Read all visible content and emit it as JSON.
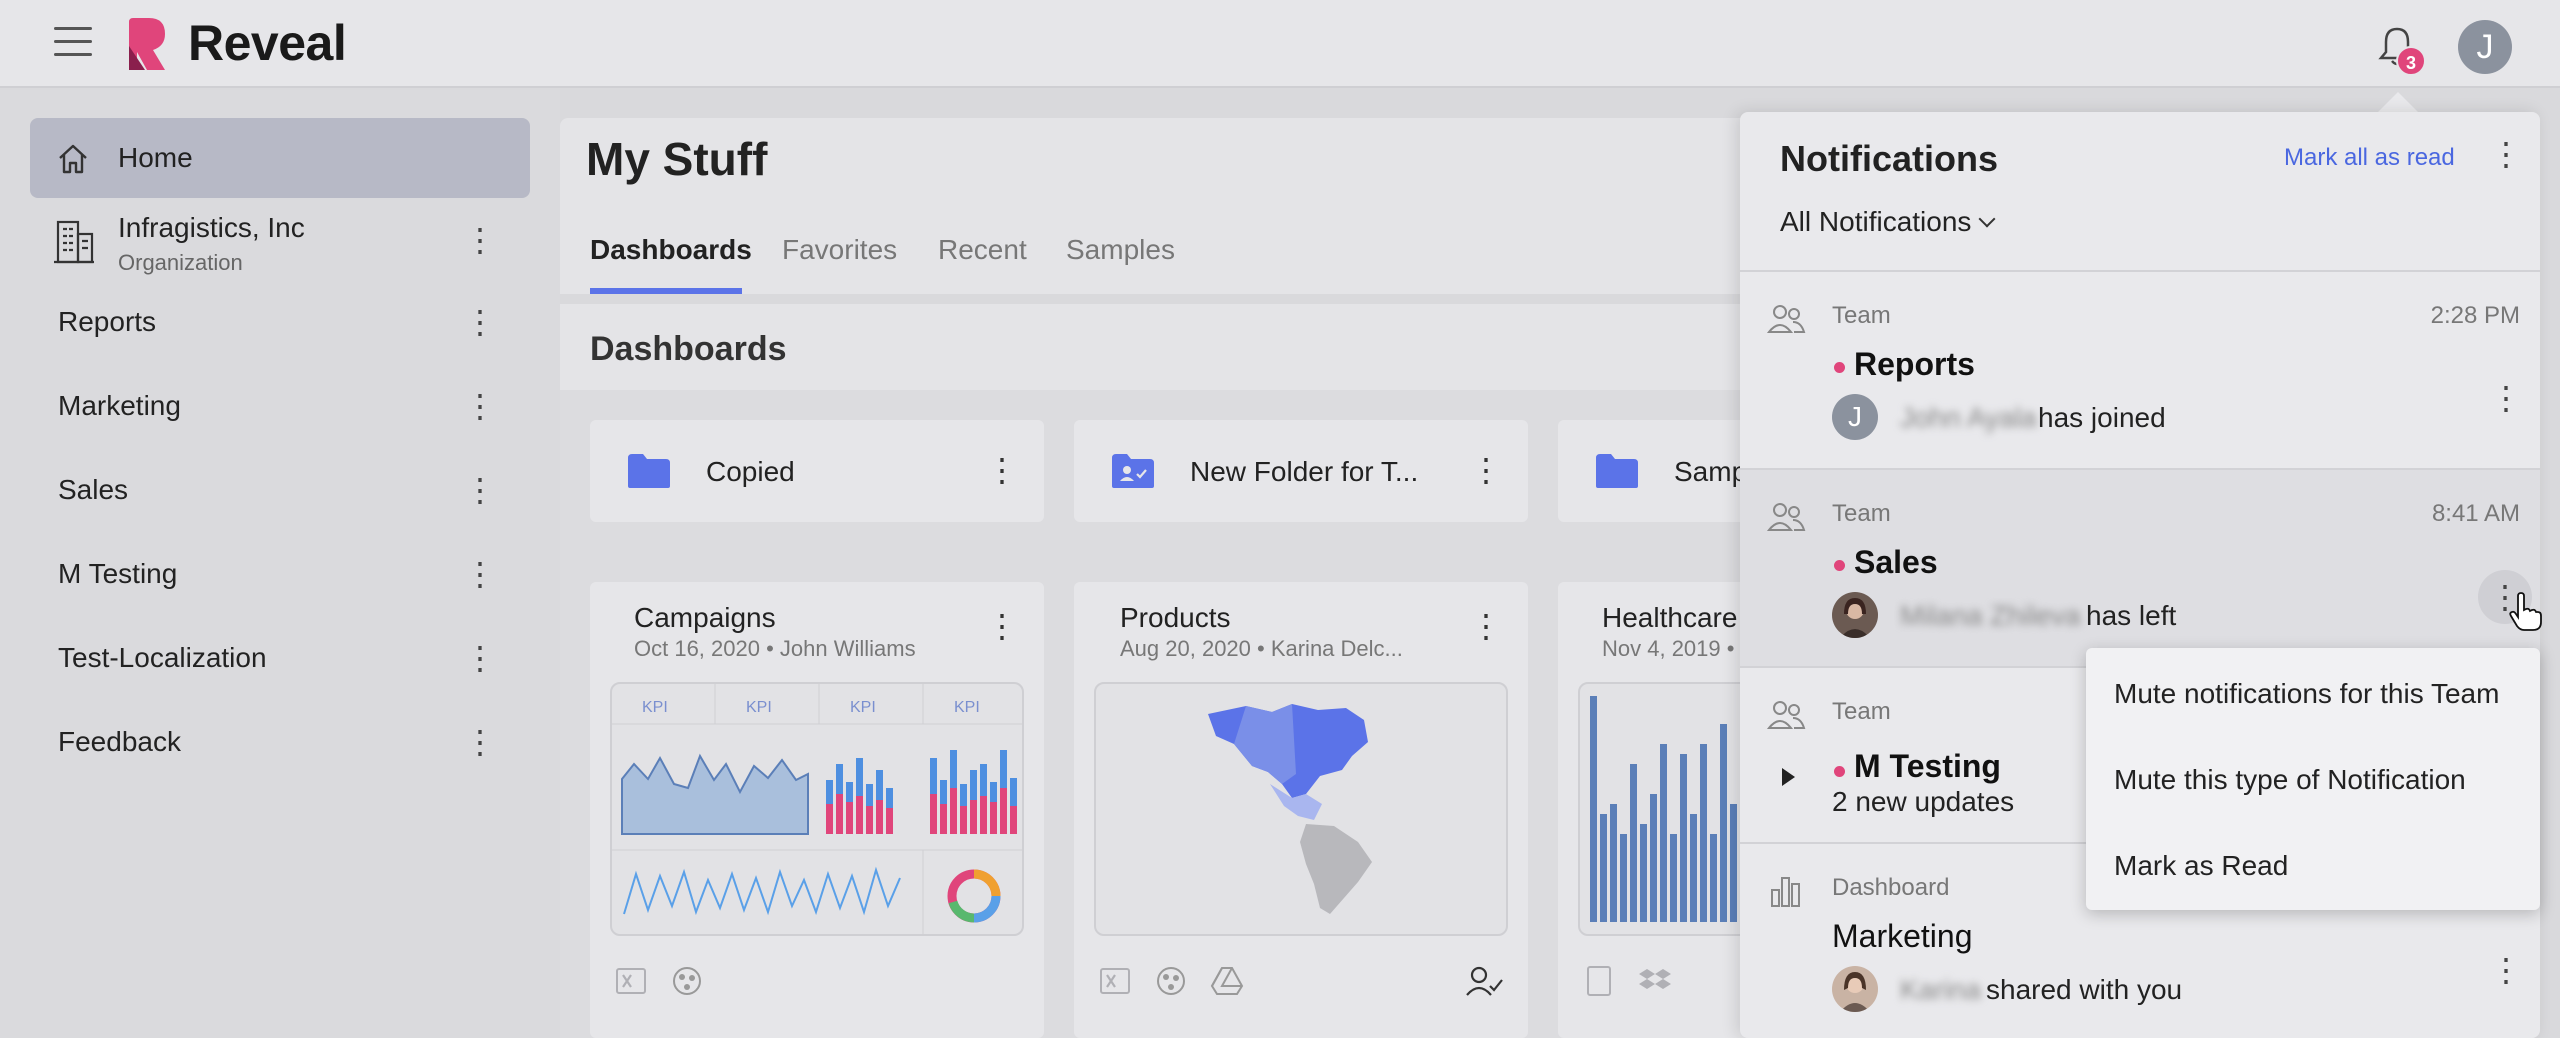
{
  "app": {
    "brand": "Reveal",
    "user_initial": "J",
    "notification_count": "3"
  },
  "sidebar": {
    "items": [
      {
        "label": "Home",
        "active": true
      },
      {
        "label": "Infragistics, Inc",
        "sublabel": "Organization"
      },
      {
        "label": "Reports"
      },
      {
        "label": "Marketing"
      },
      {
        "label": "Sales"
      },
      {
        "label": "M Testing"
      },
      {
        "label": "Test-Localization"
      },
      {
        "label": "Feedback"
      }
    ]
  },
  "main": {
    "title": "My Stuff",
    "tabs": [
      "Dashboards",
      "Favorites",
      "Recent",
      "Samples"
    ],
    "section_title": "Dashboards",
    "folders": [
      {
        "label": "Copied"
      },
      {
        "label": "New Folder for T..."
      },
      {
        "label": "Samp"
      }
    ],
    "dashboards": [
      {
        "title": "Campaigns",
        "meta": "Oct 16, 2020 • John Williams"
      },
      {
        "title": "Products",
        "meta": "Aug 20, 2020 • Karina Delc..."
      },
      {
        "title": "Healthcare",
        "meta": "Nov 4, 2019 •"
      }
    ],
    "kpi_label": "KPI"
  },
  "notifications": {
    "title": "Notifications",
    "mark_all": "Mark all as read",
    "filter": "All Notifications",
    "items": [
      {
        "category": "Team",
        "time": "2:28 PM",
        "name": "Reports",
        "avatar": "J",
        "actor": "John Ayala",
        "action": "has joined"
      },
      {
        "category": "Team",
        "time": "8:41 AM",
        "name": "Sales",
        "actor": "Milana Zhileva",
        "action": "has left"
      },
      {
        "category": "Team",
        "time": "",
        "name": "M Testing",
        "sub": "2 new updates"
      },
      {
        "category": "Dashboard",
        "time": "",
        "name": "Marketing",
        "actor": "Karina",
        "action": "shared with you"
      }
    ],
    "context_menu": [
      "Mute notifications for this Team",
      "Mute this type of Notification",
      "Mark as Read"
    ]
  },
  "colors": {
    "accent": "#5b73e8",
    "badge": "#e0457b",
    "link": "#4a67e0"
  }
}
